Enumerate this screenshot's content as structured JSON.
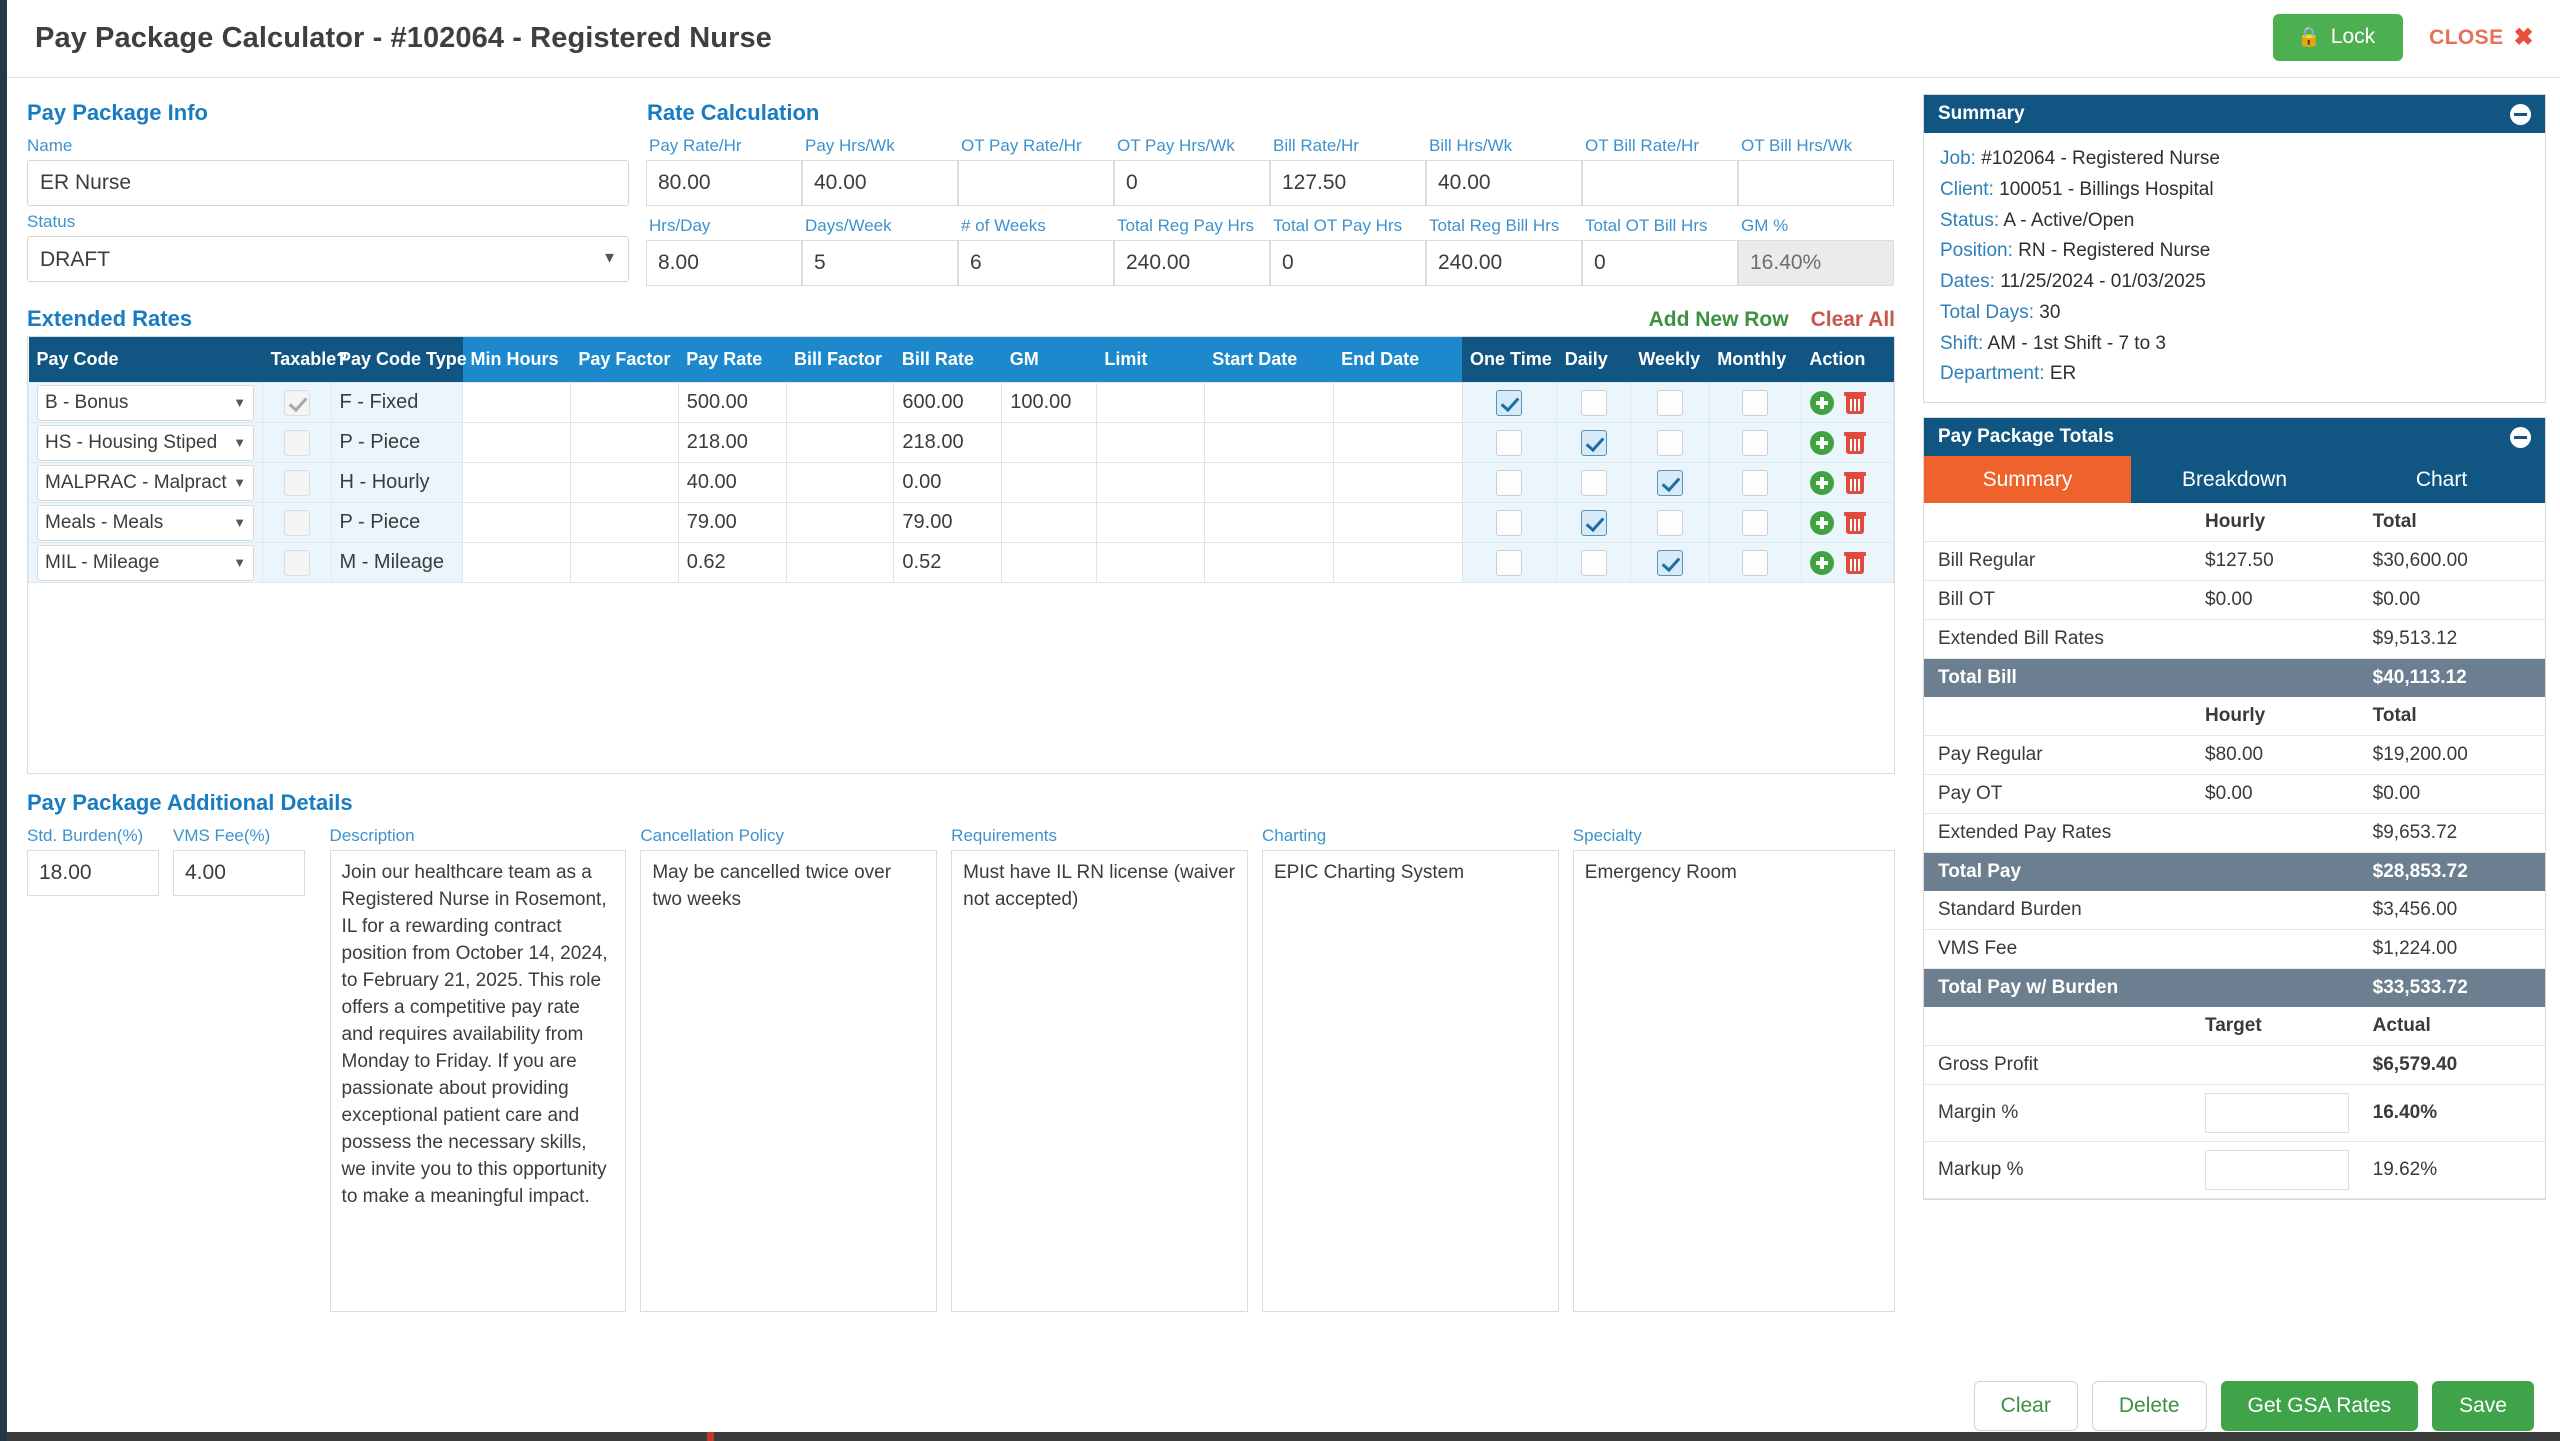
{
  "header": {
    "title": "Pay Package Calculator - #102064 - Registered Nurse",
    "lock_label": "Lock",
    "lock_icon": "lock-icon",
    "close_label": "CLOSE",
    "close_icon": "close-x-icon"
  },
  "pay_package_info": {
    "section_title": "Pay Package Info",
    "name_label": "Name",
    "name_value": "ER Nurse",
    "status_label": "Status",
    "status_value": "DRAFT",
    "status_options": [
      "DRAFT"
    ]
  },
  "rate_calculation": {
    "section_title": "Rate Calculation",
    "fields": [
      {
        "label": "Pay Rate/Hr",
        "value": "80.00",
        "readonly": false
      },
      {
        "label": "Pay Hrs/Wk",
        "value": "40.00",
        "readonly": false
      },
      {
        "label": "OT Pay Rate/Hr",
        "value": "",
        "readonly": false
      },
      {
        "label": "OT Pay Hrs/Wk",
        "value": "0",
        "readonly": false
      },
      {
        "label": "Bill Rate/Hr",
        "value": "127.50",
        "readonly": false
      },
      {
        "label": "Bill Hrs/Wk",
        "value": "40.00",
        "readonly": false
      },
      {
        "label": "OT Bill Rate/Hr",
        "value": "",
        "readonly": false
      },
      {
        "label": "OT Bill Hrs/Wk",
        "value": "",
        "readonly": false
      },
      {
        "label": "Hrs/Day",
        "value": "8.00",
        "readonly": false
      },
      {
        "label": "Days/Week",
        "value": "5",
        "readonly": false
      },
      {
        "label": "# of Weeks",
        "value": "6",
        "readonly": false
      },
      {
        "label": "Total Reg Pay Hrs",
        "value": "240.00",
        "readonly": false
      },
      {
        "label": "Total OT Pay Hrs",
        "value": "0",
        "readonly": false
      },
      {
        "label": "Total Reg Bill Hrs",
        "value": "240.00",
        "readonly": false
      },
      {
        "label": "Total OT Bill Hrs",
        "value": "0",
        "readonly": false
      },
      {
        "label": "GM %",
        "value": "16.40%",
        "readonly": true
      }
    ]
  },
  "extended_rates": {
    "section_title": "Extended Rates",
    "add_new_row_label": "Add New Row",
    "clear_all_label": "Clear All",
    "columns": [
      "Pay Code",
      "Taxable?",
      "Pay Code Type",
      "Min Hours",
      "Pay Factor",
      "Pay Rate",
      "Bill Factor",
      "Bill Rate",
      "GM",
      "Limit",
      "Start Date",
      "End Date",
      "One Time",
      "Daily",
      "Weekly",
      "Monthly",
      "Action"
    ],
    "rows": [
      {
        "pay_code": "B - Bonus",
        "taxable": true,
        "pay_code_type": "F - Fixed",
        "min_hours": "",
        "pay_factor": "",
        "pay_rate": "500.00",
        "bill_factor": "",
        "bill_rate": "600.00",
        "gm": "100.00",
        "limit": "",
        "start_date": "",
        "end_date": "",
        "one_time": true,
        "daily": false,
        "weekly": false,
        "monthly": false
      },
      {
        "pay_code": "HS - Housing Stiped",
        "taxable": false,
        "pay_code_type": "P - Piece",
        "min_hours": "",
        "pay_factor": "",
        "pay_rate": "218.00",
        "bill_factor": "",
        "bill_rate": "218.00",
        "gm": "",
        "limit": "",
        "start_date": "",
        "end_date": "",
        "one_time": false,
        "daily": true,
        "weekly": false,
        "monthly": false
      },
      {
        "pay_code": "MALPRAC - Malpractice",
        "taxable": false,
        "pay_code_type": "H - Hourly",
        "min_hours": "",
        "pay_factor": "",
        "pay_rate": "40.00",
        "bill_factor": "",
        "bill_rate": "0.00",
        "gm": "",
        "limit": "",
        "start_date": "",
        "end_date": "",
        "one_time": false,
        "daily": false,
        "weekly": true,
        "monthly": false
      },
      {
        "pay_code": "Meals - Meals",
        "taxable": false,
        "pay_code_type": "P - Piece",
        "min_hours": "",
        "pay_factor": "",
        "pay_rate": "79.00",
        "bill_factor": "",
        "bill_rate": "79.00",
        "gm": "",
        "limit": "",
        "start_date": "",
        "end_date": "",
        "one_time": false,
        "daily": true,
        "weekly": false,
        "monthly": false
      },
      {
        "pay_code": "MIL - Mileage",
        "taxable": false,
        "pay_code_type": "M - Mileage",
        "min_hours": "",
        "pay_factor": "",
        "pay_rate": "0.62",
        "bill_factor": "",
        "bill_rate": "0.52",
        "gm": "",
        "limit": "",
        "start_date": "",
        "end_date": "",
        "one_time": false,
        "daily": false,
        "weekly": true,
        "monthly": false
      }
    ]
  },
  "additional_details": {
    "section_title": "Pay Package Additional Details",
    "std_burden_label": "Std. Burden(%)",
    "std_burden_value": "18.00",
    "vms_fee_label": "VMS Fee(%)",
    "vms_fee_value": "4.00",
    "description_label": "Description",
    "description_value": "Join our healthcare team as a Registered Nurse in Rosemont, IL for a rewarding contract position from October 14, 2024, to February 21, 2025. This role offers a competitive pay rate and requires availability from Monday to Friday. If you are passionate about providing exceptional patient care and possess the necessary skills, we invite you to this opportunity to make a meaningful impact.",
    "cancellation_label": "Cancellation Policy",
    "cancellation_value": "May be cancelled twice over two weeks",
    "requirements_label": "Requirements",
    "requirements_value": "Must have IL RN license (waiver not accepted)",
    "charting_label": "Charting",
    "charting_value": "EPIC Charting System",
    "specialty_label": "Specialty",
    "specialty_value": "Emergency Room"
  },
  "summary_panel": {
    "title": "Summary",
    "collapse_icon": "minus-circle-icon",
    "lines": [
      {
        "label": "Job:",
        "value": "#102064 - Registered Nurse"
      },
      {
        "label": "Client:",
        "value": "100051 - Billings Hospital"
      },
      {
        "label": "Status:",
        "value": "A - Active/Open"
      },
      {
        "label": "Position:",
        "value": "RN - Registered Nurse"
      },
      {
        "label": "Dates:",
        "value": "11/25/2024 - 01/03/2025"
      },
      {
        "label": "Total Days:",
        "value": "30"
      },
      {
        "label": "Shift:",
        "value": "AM - 1st Shift - 7 to 3"
      },
      {
        "label": "Department:",
        "value": "ER"
      }
    ]
  },
  "totals_panel": {
    "title": "Pay Package Totals",
    "collapse_icon": "minus-circle-icon",
    "tabs": [
      {
        "label": "Summary",
        "active": true
      },
      {
        "label": "Breakdown",
        "active": false
      },
      {
        "label": "Chart",
        "active": false
      }
    ],
    "bill_head": {
      "col2": "Hourly",
      "col3": "Total"
    },
    "bill_rows": [
      {
        "label": "Bill Regular",
        "hourly": "$127.50",
        "total": "$30,600.00"
      },
      {
        "label": "Bill OT",
        "hourly": "$0.00",
        "total": "$0.00"
      },
      {
        "label": "Extended Bill Rates",
        "hourly": "",
        "total": "$9,513.12"
      }
    ],
    "total_bill": {
      "label": "Total Bill",
      "value": "$40,113.12"
    },
    "pay_head": {
      "col2": "Hourly",
      "col3": "Total"
    },
    "pay_rows": [
      {
        "label": "Pay Regular",
        "hourly": "$80.00",
        "total": "$19,200.00"
      },
      {
        "label": "Pay OT",
        "hourly": "$0.00",
        "total": "$0.00"
      },
      {
        "label": "Extended Pay Rates",
        "hourly": "",
        "total": "$9,653.72"
      }
    ],
    "total_pay": {
      "label": "Total Pay",
      "value": "$28,853.72"
    },
    "burden_rows": [
      {
        "label": "Standard Burden",
        "hourly": "",
        "total": "$3,456.00"
      },
      {
        "label": "VMS Fee",
        "hourly": "",
        "total": "$1,224.00"
      }
    ],
    "total_pay_burden": {
      "label": "Total Pay w/ Burden",
      "value": "$33,533.72"
    },
    "profit_head": {
      "col2": "Target",
      "col3": "Actual"
    },
    "gross_profit": {
      "label": "Gross Profit",
      "target": "",
      "actual": "$6,579.40"
    },
    "margin": {
      "label": "Margin %",
      "target": "",
      "actual": "16.40%"
    },
    "markup": {
      "label": "Markup %",
      "target": "",
      "actual": "19.62%"
    }
  },
  "footer": {
    "clear_label": "Clear",
    "delete_label": "Delete",
    "gsa_label": "Get GSA Rates",
    "save_label": "Save"
  },
  "colors": {
    "brand_dark": "#115683",
    "brand_blue": "#1d89cc",
    "accent_orange": "#f0622b",
    "green": "#3fa34a",
    "red": "#e04a3f",
    "band_gray": "#6c7f91"
  }
}
